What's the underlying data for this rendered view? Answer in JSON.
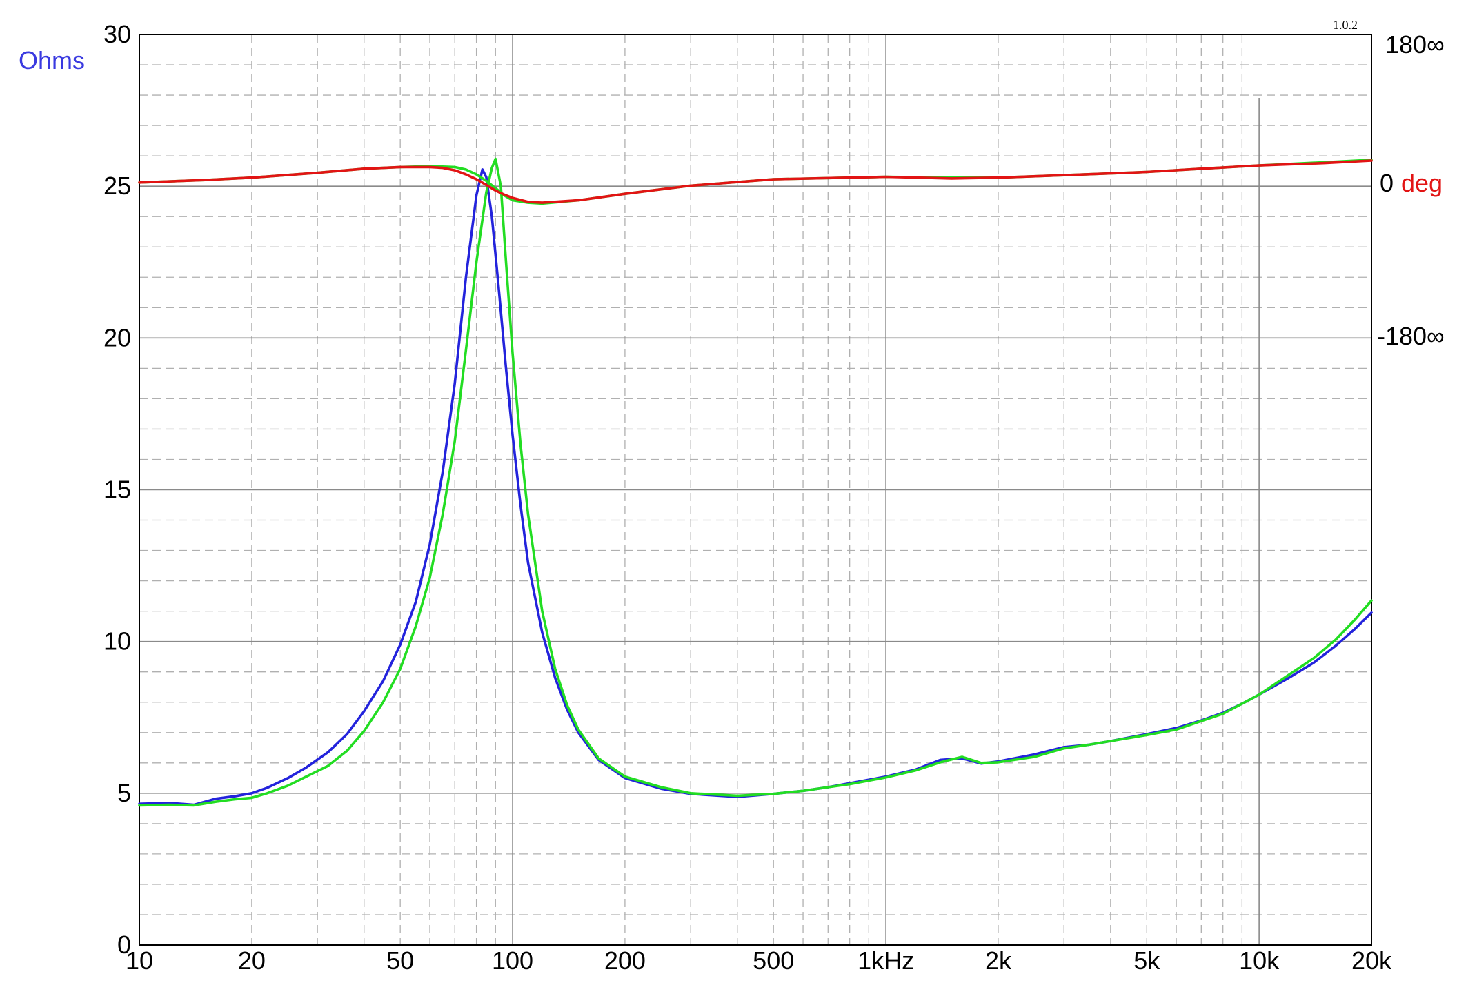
{
  "version_label": "1.0.2",
  "chart_data": {
    "type": "line",
    "x_scale": "log",
    "xlim": [
      10,
      20000
    ],
    "ylim": [
      0,
      30
    ],
    "y2lim": [
      -180,
      180
    ],
    "grid": true,
    "y_title": "Ohms",
    "y2_unit_value": "0",
    "y2_unit_label": "deg",
    "x_ticks": [
      {
        "value": 10,
        "label": "10"
      },
      {
        "value": 20,
        "label": "20"
      },
      {
        "value": 50,
        "label": "50"
      },
      {
        "value": 100,
        "label": "100"
      },
      {
        "value": 200,
        "label": "200"
      },
      {
        "value": 500,
        "label": "500"
      },
      {
        "value": 1000,
        "label": "1kHz"
      },
      {
        "value": 2000,
        "label": "2k"
      },
      {
        "value": 5000,
        "label": "5k"
      },
      {
        "value": 10000,
        "label": "10k"
      },
      {
        "value": 20000,
        "label": "20k"
      }
    ],
    "y_ticks": [
      {
        "value": 0,
        "label": "0"
      },
      {
        "value": 5,
        "label": "5"
      },
      {
        "value": 10,
        "label": "10"
      },
      {
        "value": 15,
        "label": "15"
      },
      {
        "value": 20,
        "label": "20"
      },
      {
        "value": 25,
        "label": "25"
      },
      {
        "value": 30,
        "label": "30"
      }
    ],
    "y2_ticks": [
      {
        "value": 180,
        "label": "180∞"
      },
      {
        "value": -180,
        "label": "-180∞"
      }
    ],
    "colors": {
      "impedance_a": "#2323dc",
      "impedance_b": "#22dd22",
      "phase_a": "#e21414",
      "phase_b": "#22dd22",
      "ohms_title": "#3a3ae0",
      "deg_label": "#e21414",
      "grid_major": "#8a8a8a",
      "grid_minor": "#b0b0b0"
    },
    "series": [
      {
        "axis": "left",
        "color_key": "impedance_a",
        "x": [
          10,
          12,
          14,
          16,
          18,
          20,
          22,
          25,
          28,
          32,
          36,
          40,
          45,
          50,
          55,
          60,
          65,
          70,
          75,
          80,
          83,
          85,
          88,
          92,
          96,
          100,
          105,
          110,
          120,
          130,
          140,
          150,
          170,
          200,
          250,
          300,
          400,
          500,
          600,
          700,
          800,
          1000,
          1200,
          1400,
          1600,
          1800,
          2000,
          2500,
          3000,
          3500,
          4000,
          5000,
          6000,
          7000,
          8000,
          9000,
          10000,
          12000,
          14000,
          16000,
          18000,
          20000
        ],
        "y": [
          4.65,
          4.68,
          4.62,
          4.82,
          4.9,
          5.0,
          5.18,
          5.5,
          5.85,
          6.35,
          6.95,
          7.7,
          8.7,
          9.9,
          11.3,
          13.2,
          15.6,
          18.5,
          22.0,
          24.7,
          25.55,
          25.3,
          24.0,
          21.5,
          19.0,
          16.8,
          14.5,
          12.6,
          10.3,
          8.8,
          7.75,
          7.0,
          6.1,
          5.5,
          5.15,
          4.98,
          4.88,
          4.98,
          5.08,
          5.2,
          5.33,
          5.55,
          5.78,
          6.1,
          6.15,
          5.98,
          6.05,
          6.28,
          6.52,
          6.6,
          6.72,
          6.95,
          7.15,
          7.4,
          7.65,
          7.95,
          8.25,
          8.8,
          9.3,
          9.85,
          10.4,
          10.95
        ]
      },
      {
        "axis": "left",
        "color_key": "impedance_b",
        "x": [
          10,
          12,
          14,
          16,
          18,
          20,
          22,
          25,
          28,
          32,
          36,
          40,
          45,
          50,
          55,
          60,
          65,
          70,
          75,
          80,
          85,
          88,
          90,
          93,
          96,
          100,
          105,
          110,
          120,
          130,
          140,
          150,
          170,
          200,
          250,
          300,
          400,
          500,
          600,
          700,
          800,
          1000,
          1200,
          1400,
          1600,
          1800,
          2000,
          2500,
          3000,
          3500,
          4000,
          5000,
          6000,
          7000,
          8000,
          9000,
          10000,
          12000,
          14000,
          16000,
          18000,
          20000
        ],
        "y": [
          4.6,
          4.62,
          4.6,
          4.72,
          4.8,
          4.85,
          5.0,
          5.25,
          5.55,
          5.9,
          6.4,
          7.05,
          8.0,
          9.1,
          10.5,
          12.1,
          14.2,
          16.6,
          19.6,
          22.5,
          24.8,
          25.6,
          25.9,
          25.0,
          22.5,
          19.5,
          16.5,
          14.2,
          11.0,
          9.1,
          7.9,
          7.1,
          6.15,
          5.55,
          5.2,
          5.0,
          4.92,
          4.98,
          5.08,
          5.2,
          5.3,
          5.52,
          5.75,
          6.02,
          6.2,
          6.0,
          6.02,
          6.2,
          6.48,
          6.6,
          6.72,
          6.92,
          7.1,
          7.38,
          7.62,
          7.95,
          8.25,
          8.9,
          9.45,
          10.05,
          10.7,
          11.35
        ]
      },
      {
        "axis": "right",
        "color_key": "phase_b",
        "x": [
          10,
          15,
          20,
          30,
          40,
          50,
          60,
          70,
          75,
          80,
          85,
          90,
          95,
          100,
          110,
          120,
          150,
          200,
          300,
          500,
          1000,
          1500,
          2000,
          3000,
          5000,
          7000,
          10000,
          15000,
          20000
        ],
        "y": [
          10,
          13,
          16,
          22,
          27,
          29,
          30,
          29,
          26,
          20,
          12,
          3,
          -6,
          -12,
          -15,
          -16,
          -12,
          -4,
          6,
          14,
          17,
          16,
          16,
          19,
          23,
          27,
          31,
          35,
          38
        ]
      },
      {
        "axis": "right",
        "color_key": "phase_a",
        "x": [
          10,
          15,
          20,
          30,
          40,
          50,
          60,
          65,
          70,
          75,
          80,
          85,
          90,
          95,
          100,
          110,
          120,
          150,
          200,
          300,
          500,
          1000,
          1500,
          2000,
          3000,
          5000,
          7000,
          10000,
          15000,
          20000
        ],
        "y": [
          10,
          13,
          16,
          22,
          27,
          29,
          29,
          28,
          25,
          20,
          14,
          7,
          0,
          -5,
          -9,
          -14,
          -15,
          -12,
          -4,
          6,
          14,
          17,
          15,
          16,
          19,
          23,
          27,
          31,
          34,
          37
        ]
      }
    ]
  }
}
